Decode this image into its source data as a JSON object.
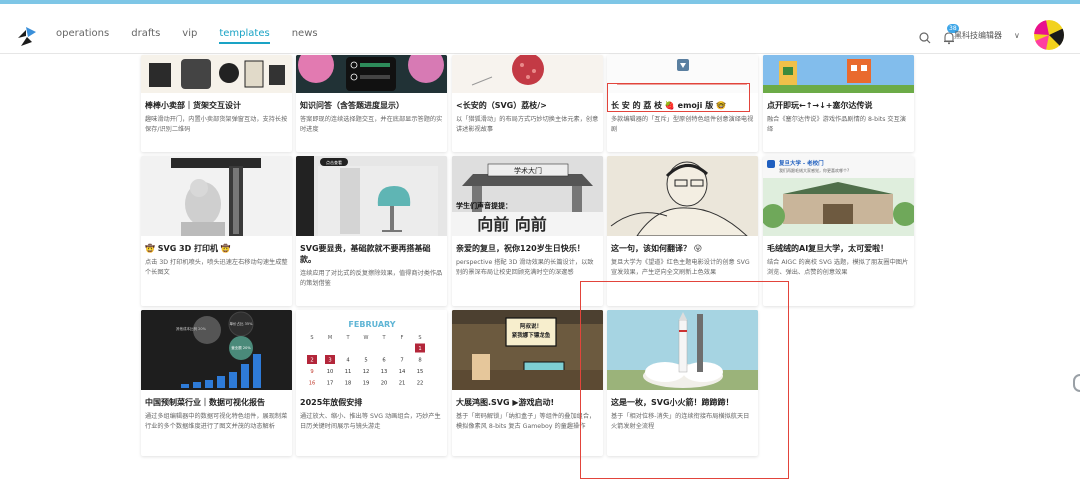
{
  "nav": {
    "items": [
      "operations",
      "drafts",
      "vip",
      "templates",
      "news"
    ],
    "active": "templates"
  },
  "header": {
    "notification_count": "38",
    "user_name": "黑科技编辑器",
    "chevron": "∨"
  },
  "colors": {
    "accent": "#1aa3c5",
    "topline": "#7ec6e6",
    "highlight_box": "#e2443b"
  },
  "row1": [
    {
      "title": "棒棒小卖部｜货架交互设计",
      "desc": "趣味滑动开门，内置小卖部货架弹窗互动，支持长按保存/识别二维码"
    },
    {
      "title": "知识问答（含答题进度显示）",
      "desc": "答案即现的连续选择题交互，并在底部显示答题的实时进度"
    },
    {
      "title": "<长安的（SVG）荔枝/>",
      "desc": "以「猎狐滑动」的布局方式巧妙切换主体元素，创意讲述影视故事"
    },
    {
      "title": "长 安 的 荔 枝 🍓 emoji 版 🤓",
      "desc": "多款编辑器的「互斥」型原创特色组件创意演绎电视剧"
    },
    {
      "title": "点开即玩←↑→↓+塞尔达传说",
      "desc": "融合《塞尔达传说》游戏作品剧情的 8-bits 交互演绎"
    }
  ],
  "row2": [
    {
      "title": "🤠 SVG 3D 打印机 🤠",
      "desc": "点击 3D 打印机喷头，喷头迅速左右移动勾速生成整个长图文"
    },
    {
      "title": "SVG要显贵，基础款就不要再搭基础款。",
      "desc": "连续应用了对比式的反复擦除效果，值得商讨类作品的策划借鉴",
      "thumb_label": "点击查看"
    },
    {
      "title": "亲爱的复旦，祝你120岁生日快乐！",
      "desc": "perspective 搭配 3D 滑动效果的长篇设计，以致别的景深布局让校史回顾充满时空的深邃感",
      "thumb_sign": "学术大门",
      "thumb_caption": "学生们声音提提：",
      "thumb_big": "向前 向前"
    },
    {
      "title": "这一句，该如何翻译？ 😛",
      "desc": "复旦大学为《望道》红色主题电影设计的创意 SVG 宣发效果，产生逆向全文刷新上色效果"
    },
    {
      "title": "毛绒绒的AI复旦大学，太可爱啦！",
      "desc": "结合 AIGC 的高校 SVG 选题，模拟了朋友圈中图片浏览、弹出、点赞的创意效果",
      "thumb_header": "复旦大学 - 老校门",
      "thumb_sub": "我们再跟毛绒大家感觉，你更喜欢哪个?"
    }
  ],
  "row3": [
    {
      "title": "中国预制菜行业｜数据可视化报告",
      "desc": "通过多组编辑器中的数据可视化特色组件，展现制菜行业的多个数据维度进行了图文并茂的动态解析",
      "bubbles": [
        "单价占比 35%",
        "营业额 20%",
        "其他成本比例 20%"
      ]
    },
    {
      "title": "2025年放假安排",
      "desc": "通过放大、缩小、推出等 SVG 动画组合，巧妙产生日历关键时间展示与镜头游走",
      "month": "FEBRUARY",
      "weekdays": [
        "S",
        "M",
        "T",
        "W",
        "T",
        "F",
        "S"
      ],
      "days": [
        "",
        "",
        "",
        "",
        "",
        "",
        "1",
        "2",
        "3",
        "4",
        "5",
        "6",
        "7",
        "8",
        "9",
        "10",
        "11",
        "12",
        "13",
        "14",
        "15",
        "16",
        "17",
        "18",
        "19",
        "20",
        "21",
        "22"
      ]
    },
    {
      "title": "大展鸿图.SVG ▶游戏启动!",
      "desc": "基于「密码解锁」「纳扣盒子」等组件的叠加组合，模拟像素风 8-bits 复古 Gameboy 的童趣操作",
      "bubble": "阿叔说！\n紧我娜下镖龙鱼"
    },
    {
      "title": "这是一枚，SVG小火箭！蹄蹄蹄！",
      "desc": "基于「相对位移-消失」的连续衔接布局横拟航天日火箭发射全流程"
    }
  ]
}
